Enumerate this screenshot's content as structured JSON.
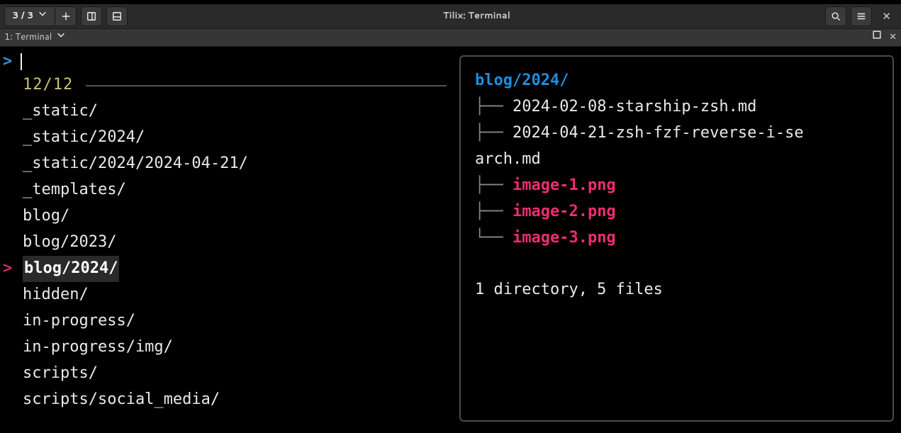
{
  "window": {
    "title": "Tilix: Terminal",
    "session_counter": "3 / 3",
    "tab_label": "1: Terminal"
  },
  "fzf": {
    "prompt_symbol": ">",
    "count": "12/12",
    "selected_index": 7,
    "items": [
      "_static/",
      "_static/2024/",
      "_static/2024/2024-04-21/",
      "_templates/",
      "blog/",
      "blog/2023/",
      "blog/2024/",
      "hidden/",
      "in-progress/",
      "in-progress/img/",
      "scripts/",
      "scripts/social_media/"
    ]
  },
  "preview": {
    "root": "blog/2024/",
    "entries": [
      {
        "branch": "├── ",
        "name": "2024-02-08-starship-zsh.md",
        "kind": "md"
      },
      {
        "branch": "├── ",
        "name": "2024-04-21-zsh-fzf-reverse-i-se",
        "wrap": "arch.md",
        "kind": "md"
      },
      {
        "branch": "├── ",
        "name": "image-1.png",
        "kind": "img"
      },
      {
        "branch": "├── ",
        "name": "image-2.png",
        "kind": "img"
      },
      {
        "branch": "└── ",
        "name": "image-3.png",
        "kind": "img"
      }
    ],
    "summary": "1 directory, 5 files"
  }
}
